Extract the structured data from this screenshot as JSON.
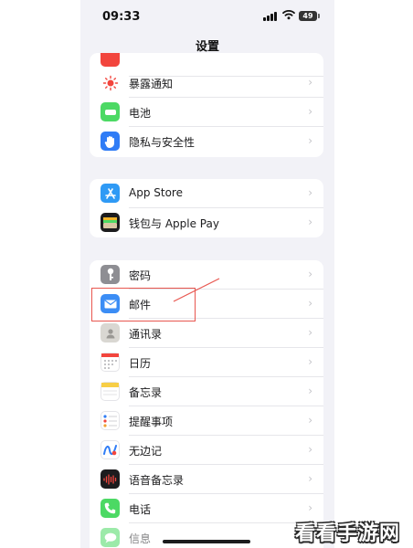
{
  "status_bar": {
    "time": "09:33",
    "battery": "49"
  },
  "nav": {
    "title": "设置"
  },
  "groups": [
    {
      "items": [
        {
          "label": "暴露通知",
          "icon": "exposure-notification-icon",
          "color": "#ffffff"
        },
        {
          "label": "电池",
          "icon": "battery-icon",
          "color": "#4cd964"
        },
        {
          "label": "隐私与安全性",
          "icon": "hand-icon",
          "color": "#2f7cf6"
        }
      ]
    },
    {
      "items": [
        {
          "label": "App Store",
          "icon": "app-store-icon",
          "color": "#2f9af5"
        },
        {
          "label": "钱包与 Apple Pay",
          "icon": "wallet-icon",
          "color": "#1c1c1e"
        }
      ]
    },
    {
      "items": [
        {
          "label": "密码",
          "icon": "key-icon",
          "color": "#8e8e93"
        },
        {
          "label": "邮件",
          "icon": "mail-icon",
          "color": "#3b8df5"
        },
        {
          "label": "通讯录",
          "icon": "contacts-icon",
          "color": "#d9d7d2"
        },
        {
          "label": "日历",
          "icon": "calendar-icon",
          "color": "#ffffff"
        },
        {
          "label": "备忘录",
          "icon": "notes-icon",
          "color": "#ffffff"
        },
        {
          "label": "提醒事项",
          "icon": "reminders-icon",
          "color": "#ffffff"
        },
        {
          "label": "无边记",
          "icon": "freeform-icon",
          "color": "#ffffff"
        },
        {
          "label": "语音备忘录",
          "icon": "voice-memos-icon",
          "color": "#1c1c1e"
        },
        {
          "label": "电话",
          "icon": "phone-icon",
          "color": "#4cd964"
        },
        {
          "label": "信息",
          "icon": "messages-icon",
          "color": "#4cd964"
        }
      ]
    }
  ],
  "chevron": "›",
  "watermark": "看看手游网"
}
